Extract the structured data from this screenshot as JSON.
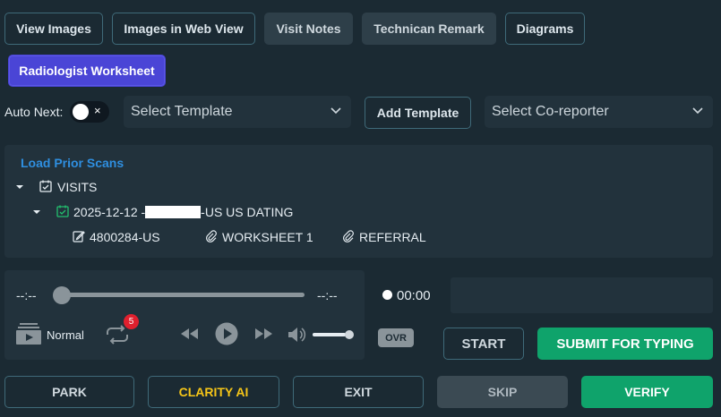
{
  "tabs": {
    "view_images": "View Images",
    "images_web_view": "Images in Web View",
    "visit_notes": "Visit Notes",
    "technician_remark": "Technican Remark",
    "diagrams": "Diagrams",
    "radiologist_worksheet": "Radiologist Worksheet"
  },
  "controls": {
    "auto_next_label": "Auto Next:",
    "auto_next_off_symbol": "×",
    "template_placeholder": "Select Template",
    "add_template": "Add Template",
    "coreporter_placeholder": "Select Co-reporter"
  },
  "prior_scans": {
    "title": "Load Prior Scans",
    "root_label": "VISITS",
    "visit_label_prefix": "2025-12-12 -",
    "visit_label_suffix": "-US US DATING",
    "children": [
      "4800284-US",
      "WORKSHEET 1",
      "REFERRAL"
    ]
  },
  "player": {
    "time_start": "--:--",
    "time_end": "--:--",
    "speed": "Normal",
    "repeat_count": "5",
    "overwrite_badge": "OVR",
    "record_time": "00:00",
    "progress_fraction": 0,
    "volume_fraction": 0.8
  },
  "actions": {
    "start": "START",
    "submit_for_typing": "SUBMIT FOR TYPING",
    "park": "PARK",
    "clarity_ai": "CLARITY AI",
    "exit": "EXIT",
    "skip": "SKIP",
    "verify": "VERIFY"
  },
  "colors": {
    "background": "#1b2a33",
    "panel": "#22323c",
    "accent_purple": "#4a45d6",
    "accent_green": "#0fa36b",
    "link_blue": "#2f8fe0",
    "clarity_yellow": "#f5c518",
    "badge_red": "#e0202e"
  }
}
